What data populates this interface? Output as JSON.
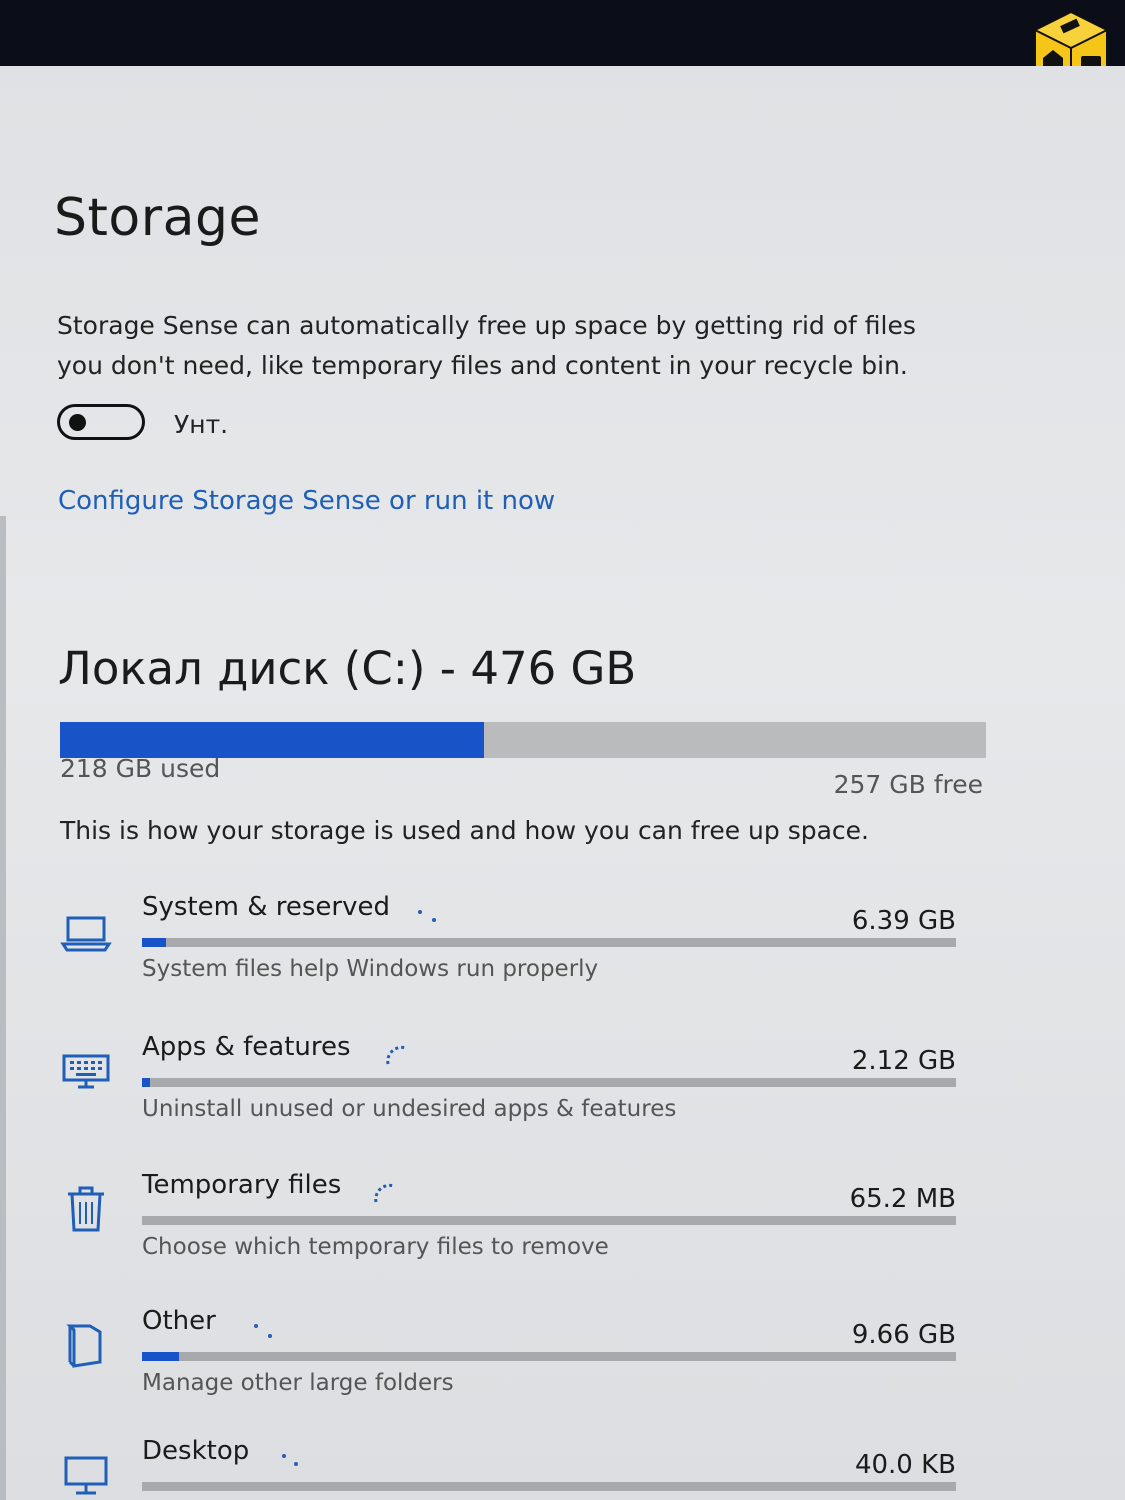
{
  "page": {
    "title": "Storage",
    "description": "Storage Sense can automatically free up space by getting rid of files you don't need, like temporary files and content in your recycle bin.",
    "storage_sense_toggle": {
      "state_label": "Унт.",
      "on": false
    },
    "configure_link": "Configure Storage Sense or run it now"
  },
  "drive": {
    "title": "Локал диск (C:) - 476 GB",
    "used_label": "218 GB used",
    "free_label": "257 GB free",
    "used_fraction": 0.458,
    "info": "This is how your storage is used and how you can free up space."
  },
  "categories": [
    {
      "name": "System & reserved",
      "size": "6.39 GB",
      "subtitle": "System files help Windows run properly",
      "icon": "laptop-icon",
      "fill_fraction": 0.03
    },
    {
      "name": "Apps & features",
      "size": "2.12 GB",
      "subtitle": "Uninstall unused or undesired apps & features",
      "icon": "keyboard-icon",
      "fill_fraction": 0.01
    },
    {
      "name": "Temporary files",
      "size": "65.2 MB",
      "subtitle": "Choose which temporary files to remove",
      "icon": "trash-icon",
      "fill_fraction": 0.0
    },
    {
      "name": "Other",
      "size": "9.66 GB",
      "subtitle": "Manage other large folders",
      "icon": "document-icon",
      "fill_fraction": 0.045
    },
    {
      "name": "Desktop",
      "size": "40.0 KB",
      "subtitle": "",
      "icon": "monitor-icon",
      "fill_fraction": 0.0
    }
  ],
  "colors": {
    "accent": "#1853c8",
    "link": "#1f5fb8",
    "bar_track": "#b9bbbd"
  }
}
